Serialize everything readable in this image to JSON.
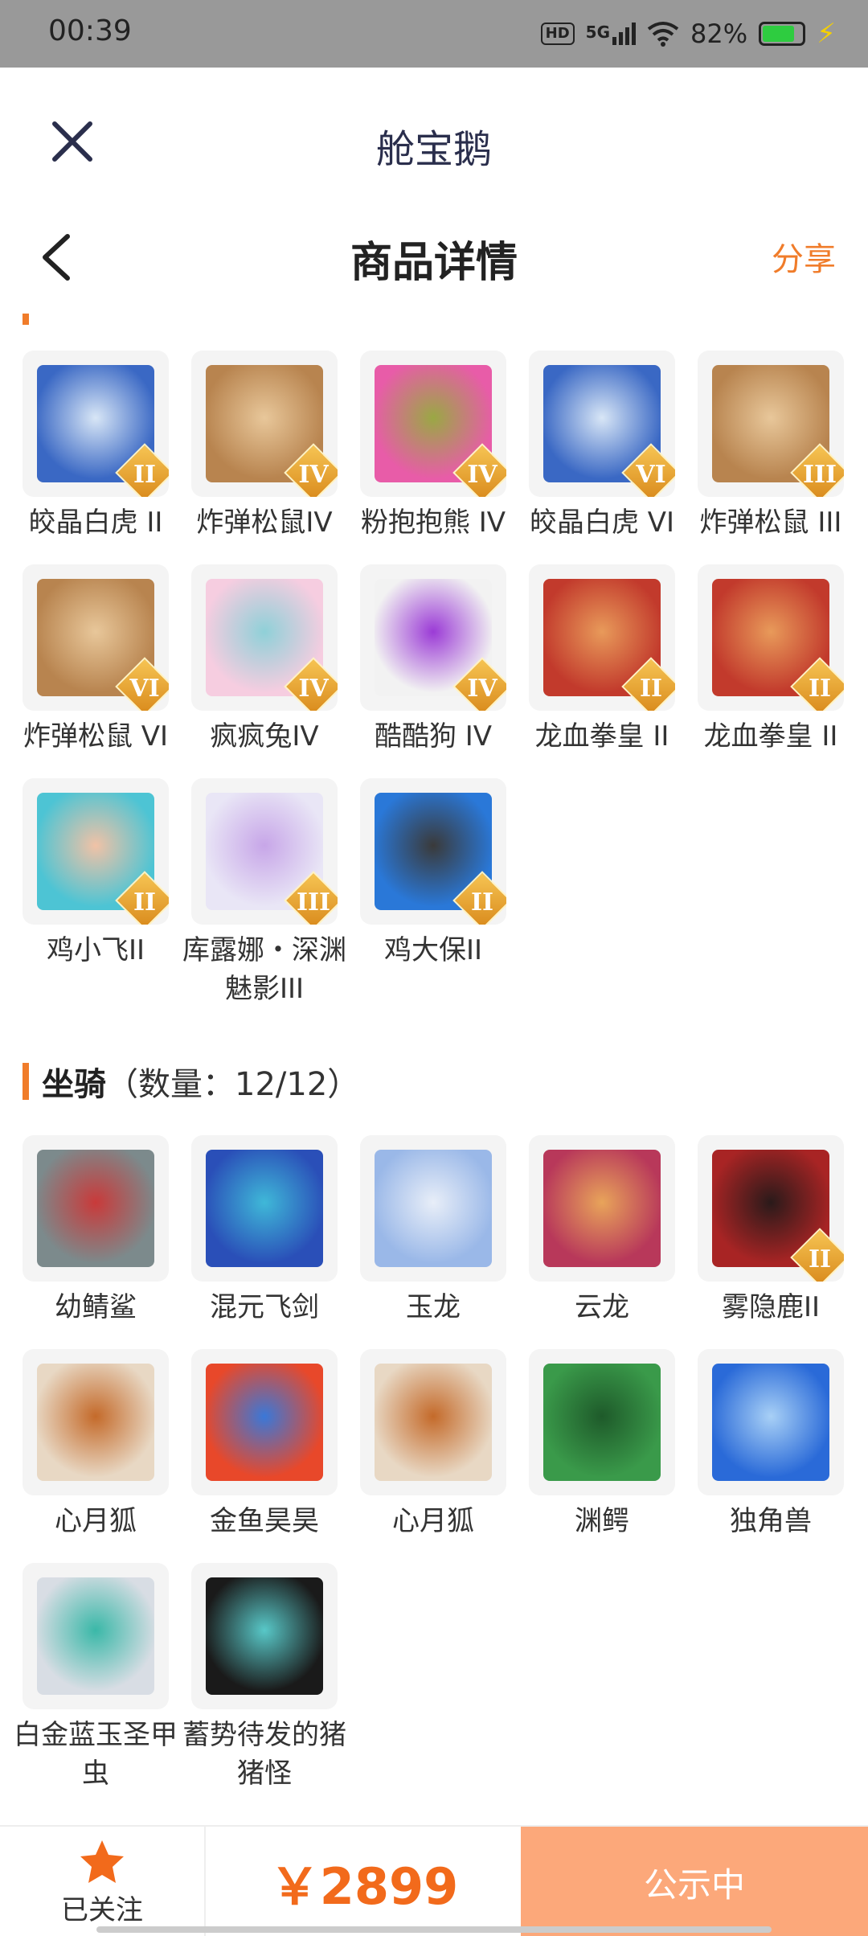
{
  "status_bar": {
    "time": "00:39",
    "network": "5G",
    "hd": "HD",
    "battery": "82%",
    "battery_level": 0.82
  },
  "mini_header": {
    "title": "舱宝鹅"
  },
  "nav": {
    "title": "商品详情",
    "share_label": "分享"
  },
  "pets_section": {
    "items": [
      {
        "name": "皎晶白虎 II",
        "tier": "II",
        "icon": "white-tiger-icon",
        "colors": [
          "#3a68c4",
          "#d8e6f6"
        ]
      },
      {
        "name": "炸弹松鼠IV",
        "tier": "IV",
        "icon": "bomb-squirrel-icon",
        "colors": [
          "#b8844f",
          "#e8c79a"
        ]
      },
      {
        "name": "粉抱抱熊 IV",
        "tier": "IV",
        "icon": "pink-bear-icon",
        "colors": [
          "#e85ca8",
          "#9aa844"
        ]
      },
      {
        "name": "皎晶白虎 VI",
        "tier": "VI",
        "icon": "white-tiger-icon",
        "colors": [
          "#3a68c4",
          "#d8e6f6"
        ]
      },
      {
        "name": "炸弹松鼠 III",
        "tier": "III",
        "icon": "bomb-squirrel-icon",
        "colors": [
          "#b8844f",
          "#e8c79a"
        ]
      },
      {
        "name": "炸弹松鼠 VI",
        "tier": "VI",
        "icon": "bomb-squirrel-icon",
        "colors": [
          "#b8844f",
          "#e8c79a"
        ]
      },
      {
        "name": "疯疯兔IV",
        "tier": "IV",
        "icon": "crazy-rabbit-icon",
        "colors": [
          "#f6cde0",
          "#8fd0d8"
        ]
      },
      {
        "name": "酷酷狗 IV",
        "tier": "IV",
        "icon": "cool-dog-icon",
        "colors": [
          "#f2f2f2",
          "#9b3bd6"
        ]
      },
      {
        "name": "龙血拳皇 II",
        "tier": "II",
        "icon": "dragon-boxer-icon",
        "colors": [
          "#c23a2c",
          "#e89a5a"
        ]
      },
      {
        "name": "龙血拳皇 II",
        "tier": "II",
        "icon": "dragon-boxer-icon",
        "colors": [
          "#c23a2c",
          "#e89a5a"
        ]
      },
      {
        "name": "鸡小飞II",
        "tier": "II",
        "icon": "chick-icon",
        "colors": [
          "#4dc4d4",
          "#f1c2a6"
        ]
      },
      {
        "name": "库露娜・深渊魅影III",
        "tier": "III",
        "icon": "kuluna-icon",
        "colors": [
          "#e9e6f6",
          "#c7a6e8"
        ]
      },
      {
        "name": "鸡大保II",
        "tier": "II",
        "icon": "chicken-boss-icon",
        "colors": [
          "#2a78d8",
          "#3a3a3a"
        ]
      }
    ]
  },
  "mounts_section": {
    "title": "坐骑",
    "count": "（数量：12/12）",
    "items": [
      {
        "name": "幼鲭鲨",
        "tier": "",
        "icon": "shark-icon",
        "colors": [
          "#7c8a8c",
          "#c93a3a"
        ]
      },
      {
        "name": "混元飞剑",
        "tier": "",
        "icon": "flying-sword-icon",
        "colors": [
          "#2a4fb8",
          "#3fb8d8"
        ]
      },
      {
        "name": "玉龙",
        "tier": "",
        "icon": "jade-dragon-icon",
        "colors": [
          "#9ab8e8",
          "#e8eef8"
        ]
      },
      {
        "name": "云龙",
        "tier": "",
        "icon": "cloud-dragon-icon",
        "colors": [
          "#b8385a",
          "#e8a45a"
        ]
      },
      {
        "name": "雾隐鹿II",
        "tier": "II",
        "icon": "mist-deer-icon",
        "colors": [
          "#a82424",
          "#2a1a1a"
        ]
      },
      {
        "name": "心月狐",
        "tier": "",
        "icon": "moon-fox-icon",
        "colors": [
          "#e8d8c4",
          "#c46a2a"
        ]
      },
      {
        "name": "金鱼昊昊",
        "tier": "",
        "icon": "goldfish-icon",
        "colors": [
          "#e8482a",
          "#3a78d8"
        ]
      },
      {
        "name": "心月狐",
        "tier": "",
        "icon": "moon-fox-icon",
        "colors": [
          "#e8d8c4",
          "#c46a2a"
        ]
      },
      {
        "name": "渊鳄",
        "tier": "",
        "icon": "crocodile-icon",
        "colors": [
          "#3a9a4a",
          "#1e5a2a"
        ]
      },
      {
        "name": "独角兽",
        "tier": "",
        "icon": "unicorn-icon",
        "colors": [
          "#2a6ad8",
          "#a8d0f6"
        ]
      },
      {
        "name": "白金蓝玉圣甲虫",
        "tier": "",
        "icon": "scarab-icon",
        "colors": [
          "#d8dde4",
          "#3ab8a8"
        ]
      },
      {
        "name": "蓄势待发的猪猪怪",
        "tier": "",
        "icon": "pig-monster-icon",
        "colors": [
          "#1a1a1a",
          "#58c8c8"
        ]
      }
    ]
  },
  "bottom_bar": {
    "follow_label": "已关注",
    "price": "￥2899",
    "status_button": "公示中",
    "accent": "#f26a1b",
    "button_color": "#fca87a"
  }
}
